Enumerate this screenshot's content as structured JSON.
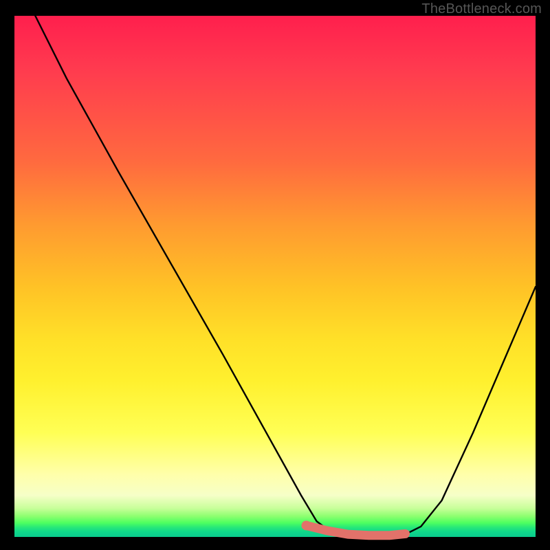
{
  "watermark": "TheBottleneck.com",
  "colors": {
    "frame": "#000000",
    "curve": "#000000",
    "highlight": "#e2726a",
    "highlight_fill": "#e2726a"
  },
  "chart_data": {
    "type": "line",
    "title": "",
    "xlabel": "",
    "ylabel": "",
    "xlim": [
      0,
      100
    ],
    "ylim": [
      0,
      100
    ],
    "series": [
      {
        "name": "bottleneck-curve",
        "x": [
          4,
          10,
          20,
          30,
          40,
          50,
          55,
          58,
          60,
          64,
          68,
          72,
          75,
          78,
          82,
          88,
          94,
          100
        ],
        "y": [
          100,
          88,
          70,
          52.5,
          35,
          17,
          8,
          3,
          1.5,
          0.5,
          0.2,
          0.2,
          0.5,
          2,
          7,
          20,
          34,
          48
        ]
      }
    ],
    "highlight_segment": {
      "comment": "thicker coral segment along the valley floor",
      "x": [
        56,
        60,
        64,
        68,
        72,
        75
      ],
      "y": [
        2.2,
        1.2,
        0.5,
        0.3,
        0.3,
        0.6
      ]
    },
    "highlight_dot": {
      "x": 56,
      "y": 2.2
    }
  }
}
